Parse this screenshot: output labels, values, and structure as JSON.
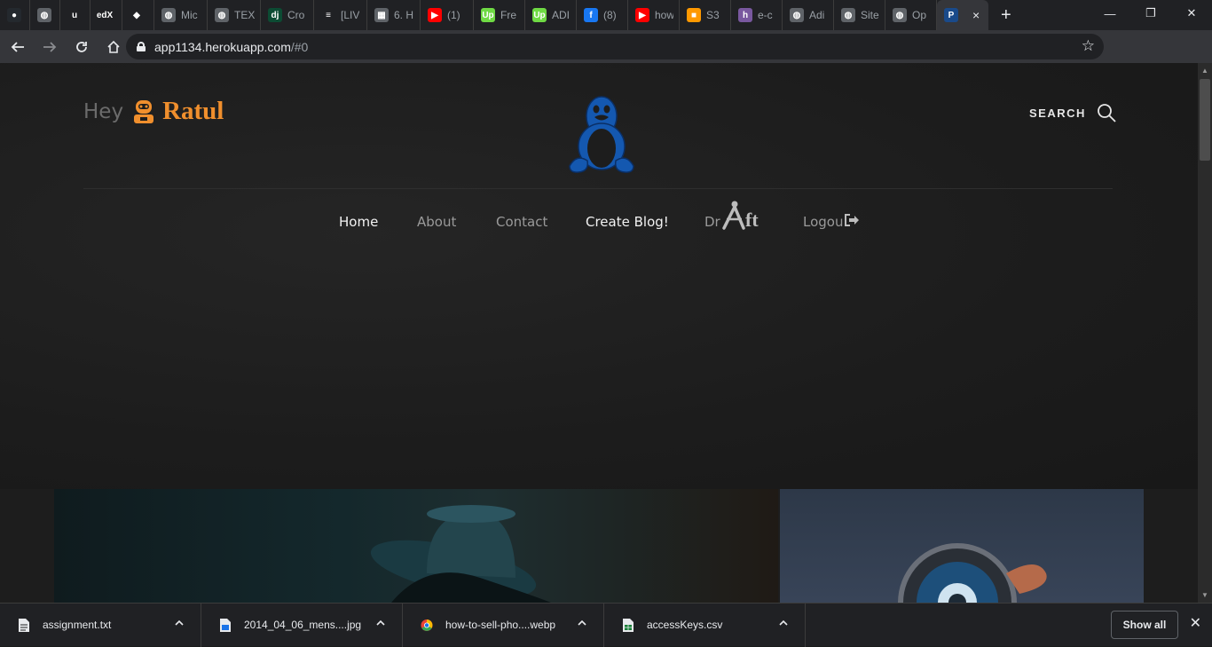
{
  "browser": {
    "tabs": [
      {
        "title": "",
        "favicon": "github-icon",
        "color": "#24292e",
        "glyph": "●"
      },
      {
        "title": "",
        "favicon": "globe-icon",
        "color": "#5f6368",
        "glyph": "◍"
      },
      {
        "title": "",
        "favicon": "udemy-icon",
        "color": "#202124",
        "glyph": "u"
      },
      {
        "title": "",
        "favicon": "edx-icon",
        "color": "#202124",
        "glyph": "edX"
      },
      {
        "title": "",
        "favicon": "mask-icon",
        "color": "#202124",
        "glyph": "◆"
      },
      {
        "title": "Mic",
        "favicon": "globe-icon",
        "color": "#5f6368",
        "glyph": "◍"
      },
      {
        "title": "TEX",
        "favicon": "globe-icon",
        "color": "#5f6368",
        "glyph": "◍"
      },
      {
        "title": "Cro",
        "favicon": "django-icon",
        "color": "#0c4b33",
        "glyph": "dj"
      },
      {
        "title": "[LIV",
        "favicon": "stackoverflow-icon",
        "color": "#202124",
        "glyph": "≡"
      },
      {
        "title": "6. H",
        "favicon": "book-icon",
        "color": "#5f6368",
        "glyph": "▦"
      },
      {
        "title": "(1)",
        "favicon": "youtube-icon",
        "color": "#ff0000",
        "glyph": "▶"
      },
      {
        "title": "Fre",
        "favicon": "upwork-icon",
        "color": "#6fda44",
        "glyph": "Up"
      },
      {
        "title": "ADI",
        "favicon": "upwork-icon",
        "color": "#6fda44",
        "glyph": "Up"
      },
      {
        "title": "(8)",
        "favicon": "facebook-icon",
        "color": "#1877f2",
        "glyph": "f"
      },
      {
        "title": "how",
        "favicon": "youtube-icon",
        "color": "#ff0000",
        "glyph": "▶"
      },
      {
        "title": "S3",
        "favicon": "aws-icon",
        "color": "#ff9900",
        "glyph": "■"
      },
      {
        "title": "e-c",
        "favicon": "heroku-icon",
        "color": "#79589f",
        "glyph": "h"
      },
      {
        "title": "Adi",
        "favicon": "globe-icon",
        "color": "#5f6368",
        "glyph": "◍"
      },
      {
        "title": "Site",
        "favicon": "globe-icon",
        "color": "#5f6368",
        "glyph": "◍"
      },
      {
        "title": "Op",
        "favicon": "globe-icon",
        "color": "#5f6368",
        "glyph": "◍"
      },
      {
        "title": "",
        "favicon": "p-icon",
        "color": "#1a4a8a",
        "glyph": "P",
        "active": true
      }
    ],
    "active_tab_close": "×",
    "new_tab": "+",
    "window_controls": {
      "minimize": "—",
      "restore": "❐",
      "close": "✕"
    },
    "url_host": "app1134.herokuapp.com",
    "url_path": "/#0",
    "star": "☆"
  },
  "site": {
    "hey": "Hey",
    "user_name": "Ratul",
    "search_label": "SEARCH",
    "nav": [
      {
        "label": "Home",
        "key": "home"
      },
      {
        "label": "About",
        "key": "about"
      },
      {
        "label": "Contact",
        "key": "contact"
      },
      {
        "label": "Create Blog!",
        "key": "create-blog"
      },
      {
        "label": "Dr",
        "key": "draft"
      },
      {
        "label": "Logou",
        "key": "logout"
      }
    ],
    "draft_suffix": "ft"
  },
  "downloads": {
    "items": [
      {
        "name": "assignment.txt",
        "icon": "text-file-icon"
      },
      {
        "name": "2014_04_06_mens....jpg",
        "icon": "image-file-icon"
      },
      {
        "name": "how-to-sell-pho....webp",
        "icon": "chrome-file-icon"
      },
      {
        "name": "accessKeys.csv",
        "icon": "csv-file-icon"
      }
    ],
    "show_all": "Show all",
    "close": "✕"
  },
  "colors": {
    "accent_orange": "#f08f2d",
    "tux_blue": "#1458b0"
  }
}
